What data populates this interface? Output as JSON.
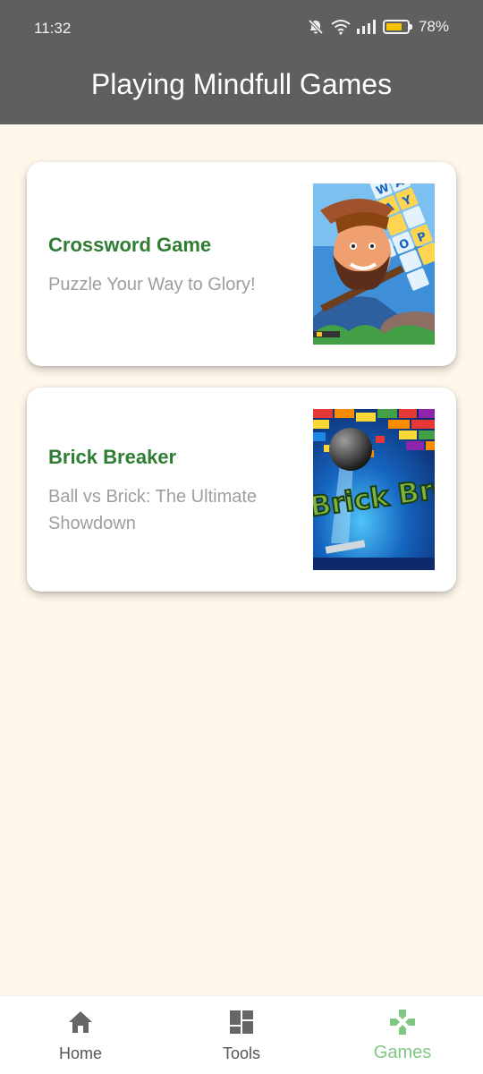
{
  "status_bar": {
    "time": "11:32",
    "battery": "78%",
    "battery_level": 0.78,
    "icons": [
      "bell-off-icon",
      "wifi-icon",
      "signal-icon",
      "battery-icon"
    ]
  },
  "app_bar": {
    "title": "Playing Mindfull Games"
  },
  "games": [
    {
      "title": "Crossword Game",
      "subtitle": "Puzzle Your Way to Glory!"
    },
    {
      "title": "Brick Breaker",
      "subtitle": "Ball vs Brick: The Ultimate Showdown",
      "image_text": "Brick Brea"
    }
  ],
  "bottom_nav": {
    "items": [
      {
        "label": "Home",
        "icon": "home-icon"
      },
      {
        "label": "Tools",
        "icon": "dashboard-icon"
      },
      {
        "label": "Games",
        "icon": "gamepad-icon",
        "active": true
      }
    ]
  },
  "colors": {
    "app_bar": "#5f5f5f",
    "background": "#fff7ea",
    "title_green": "#2e7d32",
    "active_nav": "#81c784",
    "subtitle_gray": "#9e9e9e"
  }
}
